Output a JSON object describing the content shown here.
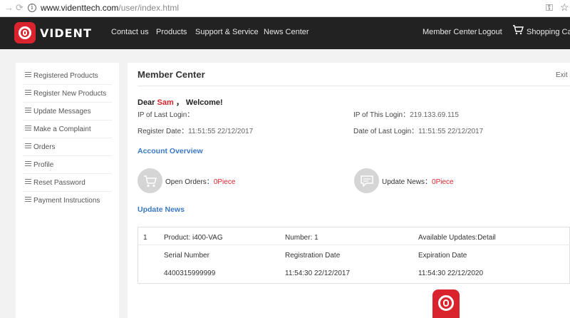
{
  "browser": {
    "url_domain": "www.videnttech.com",
    "url_path": "/user/index.html"
  },
  "header": {
    "brand": "VIDENT",
    "nav": [
      "Contact us",
      "Products",
      "Support & Service",
      "News Center"
    ],
    "member_center": "Member Center",
    "logout": "Logout",
    "cart": "Shopping Cart"
  },
  "sidebar": {
    "items": [
      {
        "label": "Registered Products"
      },
      {
        "label": "Register New Products"
      },
      {
        "label": "Update Messages"
      },
      {
        "label": "Make a Complaint"
      },
      {
        "label": "Orders"
      },
      {
        "label": "Profile"
      },
      {
        "label": "Reset Password"
      },
      {
        "label": "Payment Instructions"
      }
    ]
  },
  "main": {
    "title": "Member Center",
    "exit": "Exit",
    "welcome_prefix": "Dear",
    "user_name": "Sam",
    "welcome_suffix": "，  Welcome!",
    "ip_last_label": "IP of Last Login：",
    "ip_last_value": "",
    "ip_this_label": "IP of This Login：",
    "ip_this_value": "219.133.69.115",
    "register_label": "Register Date：",
    "register_value": "11:51:55 22/12/2017",
    "last_login_label": "Date of Last Login：",
    "last_login_value": "11:51:55 22/12/2017",
    "account_overview": "Account Overview",
    "open_orders_label": "Open Orders：",
    "open_orders_value": "0Piece",
    "update_news_label": "Update News：",
    "update_news_value": "0Piece",
    "update_news_title": "Update News",
    "news": {
      "index": "1",
      "product": "Product: i400-VAG",
      "number": "Number: 1",
      "available": "Available Updates:Detail",
      "headers": [
        "Serial Number",
        "Registration Date",
        "Expiration Date"
      ],
      "values": [
        "4400315999999",
        "11:54:30 22/12/2017",
        "11:54:30 22/12/2020"
      ]
    }
  },
  "colors": {
    "accent": "#d9242d",
    "link_blue": "#3a78c3",
    "header_bg": "#222222"
  }
}
